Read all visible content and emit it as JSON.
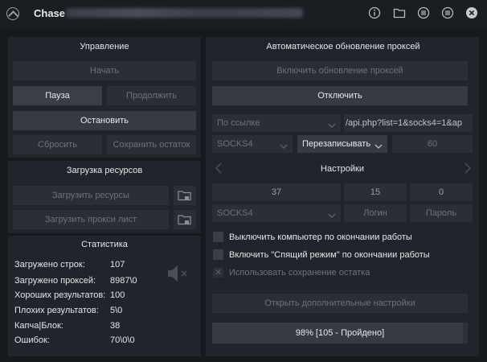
{
  "titlebar": {
    "app_name": "Chase",
    "icons": [
      "info-icon",
      "folder-icon",
      "menu-list-icon",
      "close-icon"
    ]
  },
  "control": {
    "header": "Управление",
    "start": "Начать",
    "pause": "Пауза",
    "resume": "Продолжить",
    "stop": "Остановить",
    "reset": "Сбросить",
    "save_rest": "Сохранить остаток"
  },
  "resources": {
    "header": "Загрузка ресурсов",
    "load_resources": "Загрузить ресурсы",
    "load_proxy": "Загрузить прокси лист"
  },
  "stats": {
    "header": "Статистика",
    "rows": [
      {
        "label": "Загружено строк:",
        "value": "107"
      },
      {
        "label": "Загружено проксей:",
        "value": "8987\\0"
      },
      {
        "label": "Хороших результатов:",
        "value": "100"
      },
      {
        "label": "Плохих результатов:",
        "value": "5\\0"
      },
      {
        "label": "Капча|Блок:",
        "value": "38"
      },
      {
        "label": "Ошибок:",
        "value": "70\\0\\0"
      }
    ]
  },
  "autoproxy": {
    "header": "Автоматическое обновление проксей",
    "enable": "Включить обновление проксей",
    "disable": "Отключить",
    "source_mode": "По ссылке",
    "url": "/api.php?list=1&socks4=1&ap",
    "proxy_type": "SOCKS4",
    "write_mode": "Перезаписывать",
    "interval": "60"
  },
  "settings": {
    "header": "Настройки",
    "threads": "37",
    "timeout": "15",
    "retries": "0",
    "proxy_type": "SOCKS4",
    "login_placeholder": "Логин",
    "password_placeholder": "Пароль",
    "shutdown_label": "Выключить компьютер по окончании работы",
    "sleep_label": "Включить \"Спящий режим\" по окончании работы",
    "use_save_label": "Использовать сохранение остатка",
    "open_more": "Открыть дополнительные настройки"
  },
  "progress": {
    "text": "98% [105 - Пройдено]",
    "fraction": 0.98
  }
}
